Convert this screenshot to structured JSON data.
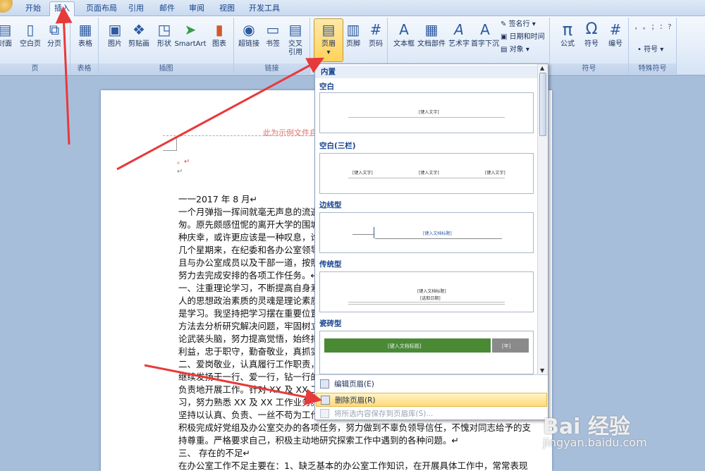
{
  "tabs": [
    "开始",
    "插入",
    "页面布局",
    "引用",
    "邮件",
    "审阅",
    "视图",
    "开发工具"
  ],
  "ribbon": {
    "pages": {
      "cover": "封面",
      "blank": "空白页",
      "break": "分页",
      "label": "页"
    },
    "tables": {
      "table": "表格",
      "label": "表格"
    },
    "illustrations": {
      "picture": "图片",
      "clipart": "剪贴画",
      "shapes": "形状",
      "smartart": "SmartArt",
      "chart": "图表",
      "label": "插图"
    },
    "links": {
      "hyperlink": "超链接",
      "bookmark": "书签",
      "crossref_1": "交叉",
      "crossref_2": "引用",
      "label": "链接"
    },
    "headerfooter": {
      "header": "页眉",
      "footer": "页脚",
      "pagenum": "页码"
    },
    "text": {
      "textbox": "文本框",
      "parts": "文档部件",
      "wordart": "艺术字",
      "dropcap": "首字下沉",
      "signature": "签名行",
      "datetime": "日期和时间",
      "object": "对象"
    },
    "symbols": {
      "formula": "公式",
      "symbol": "符号",
      "number": "编号",
      "label": "符号"
    },
    "special": {
      "symbol": "符号",
      "label": "特殊符号",
      "chars": "，  。  ；  ：  ？"
    }
  },
  "gallery": {
    "section": "内置",
    "items": [
      {
        "name": "空白",
        "text": "[键入文字]"
      },
      {
        "name": "空白(三栏)",
        "text": "[键入文字]"
      },
      {
        "name": "边线型",
        "text": "[键入文档标题]"
      },
      {
        "name": "传统型",
        "text": "[键入文档标题]",
        "text2": "[选取日期]"
      },
      {
        "name": "瓷砖型",
        "text": "[键入文档标题]",
        "text2": "[年]"
      }
    ],
    "edit": "编辑页眉(E)",
    "remove": "删除页眉(R)",
    "save": "将所选内容保存到页眉库(S)..."
  },
  "doc": {
    "header_hint": "此为示例文件自",
    "lines": [
      "一一2017 年 8 月↵",
      "一个月弹指一挥间就毫无声息的流逝",
      "匆。原先颇感忸怩的离开大学的围城",
      "种庆幸，或许更应该是一种叹息，谁",
      "几个星期来，在纪委和各办公室领导",
      "且与办公室成员以及干部一道，按照",
      "努力去完成安排的各项工作任务。↵",
      "一、注重理论学习，不断提高自身素",
      "人的思想政治素质的灵魂是理论素质",
      "是学习。我坚持把学习摆在重要位置",
      "方法去分析研究解决问题，牢固树立",
      "论武装头脑，努力提高觉悟，始终把",
      "利益，忠于职守，勤奋敬业，真抓实干",
      "二、爱岗敬业，认真履行工作职责，",
      "继续发扬干一行、爱一行，钻一行的",
      "负责地开展工作。针对 XX 及 XX 工作",
      "习，努力熟悉 XX 及 XX 工作业务。不",
      "坚持以认真、负责、一丝不苟为工作宗旨，以高效务实赢取领导的肯定和信任，在工作中，",
      "积极完成好党组及办公室交办的各项任务，努力做到不辜负领导信任，不愧对同志给予的支",
      "持尊重。严格要求自己，积极主动地研究探索工作中遇到的各种问题。↵",
      "三、  存在的不足↵",
      "在办公室工作不足主要在：1、缺乏基本的办公室工作知识，在开展具体工作中，常常表现"
    ]
  },
  "watermark": {
    "brand": "Bai 经验",
    "url": "jingyan.baidu.com"
  },
  "colors": {
    "accent": "#ffd25a",
    "arrow": "#e8393a"
  }
}
